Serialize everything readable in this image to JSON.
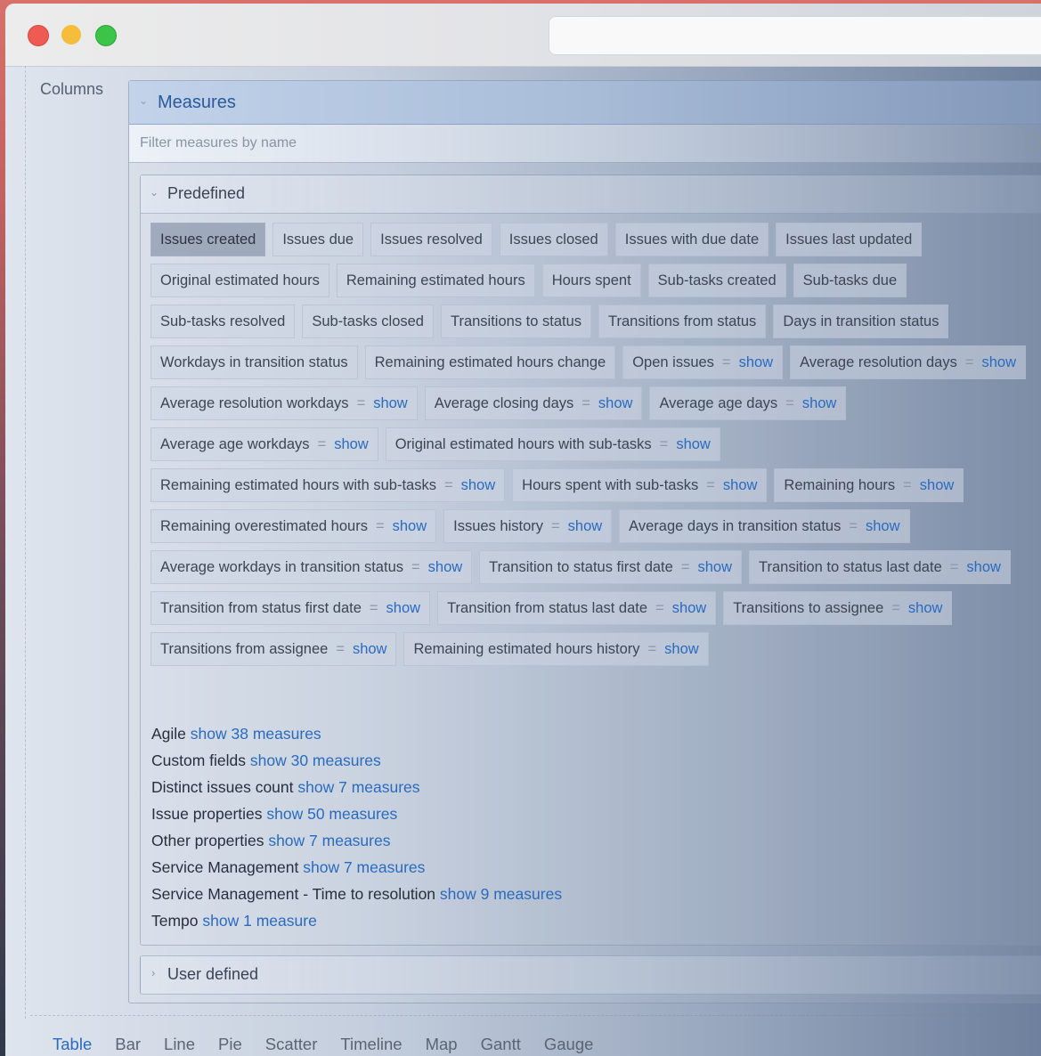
{
  "sidebar": {
    "label": "Columns"
  },
  "measures": {
    "title": "Measures",
    "filter_placeholder": "Filter measures by name",
    "predefined": {
      "title": "Predefined",
      "chips": [
        {
          "label": "Issues created",
          "selected": true
        },
        {
          "label": "Issues due"
        },
        {
          "label": "Issues resolved"
        },
        {
          "label": "Issues closed"
        },
        {
          "label": "Issues with due date"
        },
        {
          "label": "Issues last updated"
        },
        {
          "label": "Original estimated hours"
        },
        {
          "label": "Remaining estimated hours"
        },
        {
          "label": "Hours spent"
        },
        {
          "label": "Sub-tasks created"
        },
        {
          "label": "Sub-tasks due"
        },
        {
          "label": "Sub-tasks resolved"
        },
        {
          "label": "Sub-tasks closed"
        },
        {
          "label": "Transitions to status"
        },
        {
          "label": "Transitions from status"
        },
        {
          "label": "Days in transition status"
        },
        {
          "label": "Workdays in transition status"
        },
        {
          "label": "Remaining estimated hours change"
        },
        {
          "label": "Open issues",
          "show": "show"
        },
        {
          "label": "Average resolution days",
          "show": "show"
        },
        {
          "label": "Average resolution workdays",
          "show": "show"
        },
        {
          "label": "Average closing days",
          "show": "show"
        },
        {
          "label": "Average age days",
          "show": "show"
        },
        {
          "label": "Average age workdays",
          "show": "show"
        },
        {
          "label": "Original estimated hours with sub-tasks",
          "show": "show"
        },
        {
          "label": "Remaining estimated hours with sub-tasks",
          "show": "show"
        },
        {
          "label": "Hours spent with sub-tasks",
          "show": "show"
        },
        {
          "label": "Remaining hours",
          "show": "show"
        },
        {
          "label": "Remaining overestimated hours",
          "show": "show"
        },
        {
          "label": "Issues history",
          "show": "show"
        },
        {
          "label": "Average days in transition status",
          "show": "show"
        },
        {
          "label": "Average workdays in transition status",
          "show": "show"
        },
        {
          "label": "Transition to status first date",
          "show": "show"
        },
        {
          "label": "Transition to status last date",
          "show": "show"
        },
        {
          "label": "Transition from status first date",
          "show": "show"
        },
        {
          "label": "Transition from status last date",
          "show": "show"
        },
        {
          "label": "Transitions to assignee",
          "show": "show"
        },
        {
          "label": "Transitions from assignee",
          "show": "show"
        },
        {
          "label": "Remaining estimated hours history",
          "show": "show"
        }
      ],
      "eq_symbol": "=",
      "groups": [
        {
          "name": "Agile",
          "link": "show 38 measures"
        },
        {
          "name": "Custom fields",
          "link": "show 30 measures"
        },
        {
          "name": "Distinct issues count",
          "link": "show 7 measures"
        },
        {
          "name": "Issue properties",
          "link": "show 50 measures"
        },
        {
          "name": "Other properties",
          "link": "show 7 measures"
        },
        {
          "name": "Service Management",
          "link": "show 7 measures"
        },
        {
          "name": "Service Management - Time to resolution",
          "link": "show 9 measures"
        },
        {
          "name": "Tempo",
          "link": "show 1 measure"
        }
      ]
    },
    "user_defined": {
      "title": "User defined"
    }
  },
  "view_tabs": [
    {
      "label": "Table",
      "active": true
    },
    {
      "label": "Bar"
    },
    {
      "label": "Line"
    },
    {
      "label": "Pie"
    },
    {
      "label": "Scatter"
    },
    {
      "label": "Timeline"
    },
    {
      "label": "Map"
    },
    {
      "label": "Gantt"
    },
    {
      "label": "Gauge"
    }
  ],
  "colors": {
    "link": "#2a6bbf",
    "traffic_red": "#ee5b52",
    "traffic_yellow": "#f5bd3b",
    "traffic_green": "#3cc449"
  }
}
